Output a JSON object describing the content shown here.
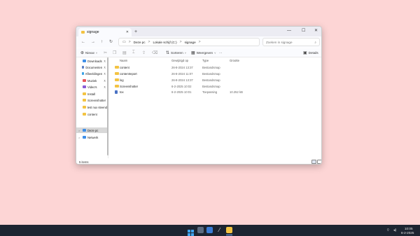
{
  "window": {
    "tab_title": "signage",
    "tab_close": "✕",
    "new_tab": "+",
    "minimize": "—",
    "maximize": "☐",
    "close": "✕"
  },
  "nav": {
    "back": "←",
    "forward": "→",
    "up": "↑",
    "refresh": "↻",
    "breadcrumb": [
      "Deze pc",
      "Lokale schijf (C:)",
      "signage"
    ],
    "breadcrumb_separator": ">",
    "search_placeholder": "Zoeken in signage",
    "search_icon": "⌕"
  },
  "toolbar": {
    "new_label": "Nieuw",
    "sort_label": "Sorteren",
    "view_label": "Weergeven",
    "more_label": "···",
    "details_label": "Details"
  },
  "sidebar": {
    "items": [
      {
        "label": "Downloads",
        "icon": "download-icon",
        "color": "#3f8fe8",
        "pinned": true
      },
      {
        "label": "Documenten",
        "icon": "document-icon",
        "color": "#5a7fc4",
        "pinned": true
      },
      {
        "label": "Afbeeldingen",
        "icon": "image-icon",
        "color": "#3aa3e6",
        "pinned": true
      },
      {
        "label": "Muziek",
        "icon": "music-icon",
        "color": "#e8555a",
        "pinned": true
      },
      {
        "label": "Video's",
        "icon": "video-icon",
        "color": "#8a5cd6",
        "pinned": true
      },
      {
        "label": "Install",
        "icon": "folder-icon",
        "color": "#f3c342",
        "pinned": false
      },
      {
        "label": "Screenshotter",
        "icon": "folder-icon",
        "color": "#f3c342",
        "pinned": false
      },
      {
        "label": "test nux steend",
        "icon": "folder-icon",
        "color": "#f3c342",
        "pinned": false
      },
      {
        "label": "content",
        "icon": "folder-icon",
        "color": "#f3c342",
        "pinned": false
      }
    ],
    "this_pc": "Deze pc",
    "network": "Netwerk",
    "pin_glyph": "⊼",
    "chevron": ">"
  },
  "columns": {
    "name": "Naam",
    "date": "Gewijzigd op",
    "type": "Type",
    "size": "Grootte"
  },
  "files": [
    {
      "name": "content",
      "date": "26-8-2024 13:37",
      "type": "Bestandsmap",
      "size": "",
      "kind": "folder"
    },
    {
      "name": "contentreport",
      "date": "26-8-2024 11:07",
      "type": "Bestandsmap",
      "size": "",
      "kind": "folder"
    },
    {
      "name": "log",
      "date": "26-8-2024 13:37",
      "type": "Bestandsmap",
      "size": "",
      "kind": "folder"
    },
    {
      "name": "Screenshotter",
      "date": "6-2-2025 10:02",
      "type": "Bestandsmap",
      "size": "",
      "kind": "folder"
    },
    {
      "name": "tox",
      "date": "6-2-2025 10:01",
      "type": "Toepassing",
      "size": "10.252 kB",
      "kind": "app"
    }
  ],
  "status": {
    "count": "5 items"
  },
  "taskbar": {
    "time": "10:05",
    "date": "6-2-2025",
    "icons": [
      "start-icon",
      "search-icon",
      "taskview-icon",
      "edge-icon",
      "explorer-icon"
    ]
  },
  "colors": {
    "desktop": "#fdd5d5",
    "taskbar": "#1d2431",
    "folder": "#f3c342",
    "accent": "#3f8fe8"
  }
}
